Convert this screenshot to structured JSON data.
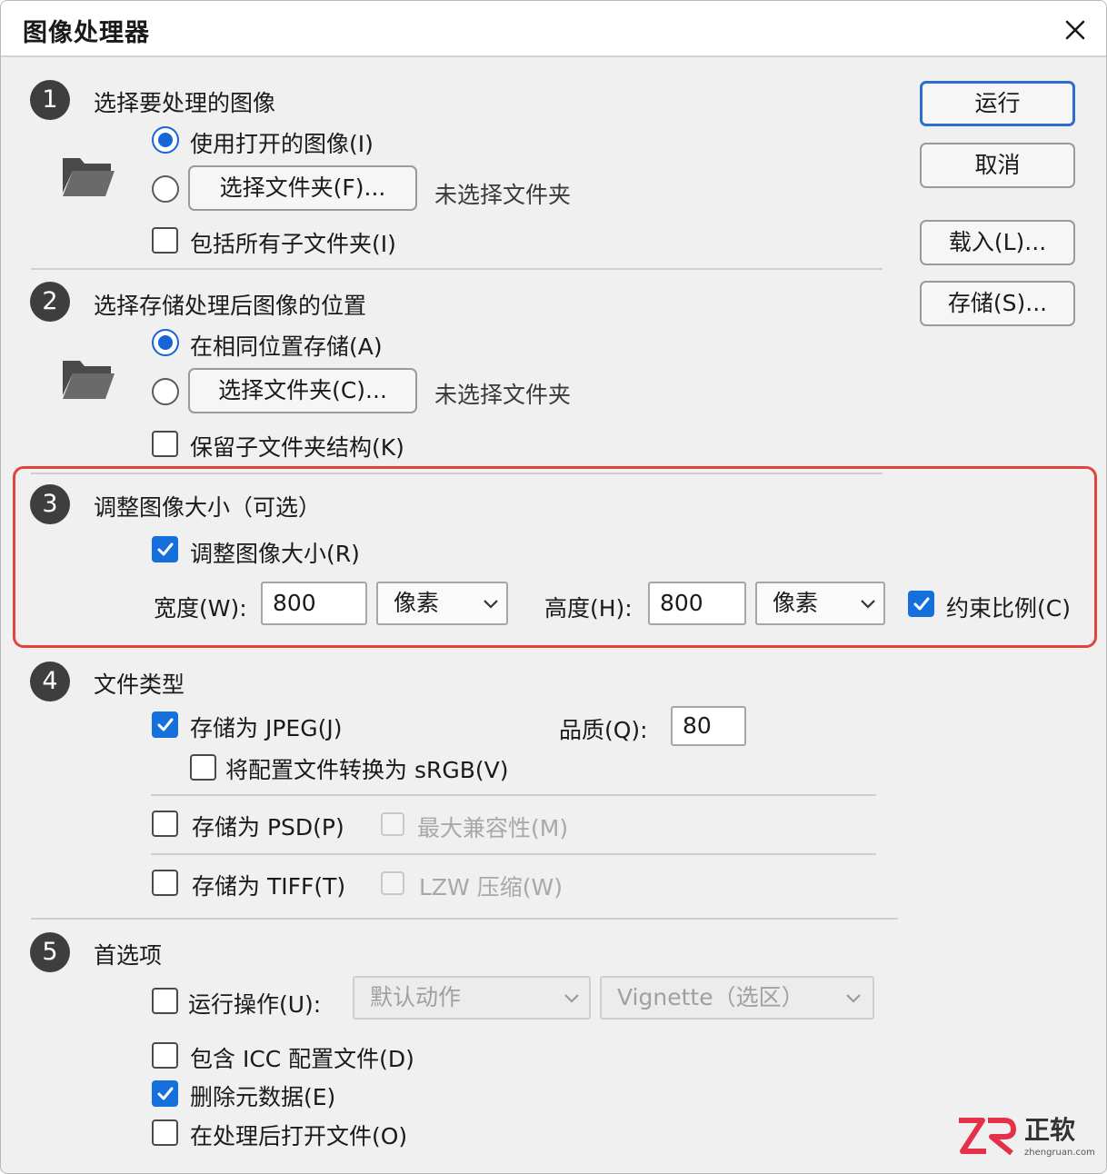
{
  "window": {
    "title": "图像处理器"
  },
  "buttons": {
    "run": "运行",
    "cancel": "取消",
    "load": "载入(L)...",
    "save": "存储(S)..."
  },
  "section1": {
    "number": "1",
    "heading": "选择要处理的图像",
    "use_open_images": "使用打开的图像(I)",
    "use_open_images_selected": true,
    "choose_folder_button": "选择文件夹(F)...",
    "no_folder_text": "未选择文件夹",
    "include_subfolders": "包括所有子文件夹(I)",
    "include_subfolders_checked": false
  },
  "section2": {
    "number": "2",
    "heading": "选择存储处理后图像的位置",
    "save_same_location": "在相同位置存储(A)",
    "save_same_location_selected": true,
    "choose_folder_button": "选择文件夹(C)...",
    "no_folder_text": "未选择文件夹",
    "keep_folder_structure": "保留子文件夹结构(K)",
    "keep_folder_structure_checked": false
  },
  "section3": {
    "number": "3",
    "heading": "调整图像大小（可选）",
    "resize": "调整图像大小(R)",
    "resize_checked": true,
    "width_label": "宽度(W):",
    "width_value": "800",
    "width_unit": "像素",
    "height_label": "高度(H):",
    "height_value": "800",
    "height_unit": "像素",
    "constrain": "约束比例(C)",
    "constrain_checked": true
  },
  "section4": {
    "number": "4",
    "heading": "文件类型",
    "save_jpeg": "存储为 JPEG(J)",
    "save_jpeg_checked": true,
    "quality_label": "品质(Q):",
    "quality_value": "80",
    "convert_srgb": "将配置文件转换为 sRGB(V)",
    "convert_srgb_checked": false,
    "save_psd": "存储为 PSD(P)",
    "save_psd_checked": false,
    "max_compat": "最大兼容性(M)",
    "save_tiff": "存储为 TIFF(T)",
    "save_tiff_checked": false,
    "lzw": "LZW 压缩(W)"
  },
  "section5": {
    "number": "5",
    "heading": "首选项",
    "run_action": "运行操作(U):",
    "run_action_checked": false,
    "action_set": "默认动作",
    "action": "Vignette（选区）",
    "include_icc": "包含 ICC 配置文件(D)",
    "include_icc_checked": false,
    "remove_metadata": "删除元数据(E)",
    "remove_metadata_checked": true,
    "open_after": "在处理后打开文件(O)",
    "open_after_checked": false
  },
  "colors": {
    "accent": "#1565d6",
    "highlight_border": "#e0443d",
    "logo_red": "#e5304a"
  },
  "watermark": {
    "brand": "正软",
    "site": "zhengruan.com"
  }
}
